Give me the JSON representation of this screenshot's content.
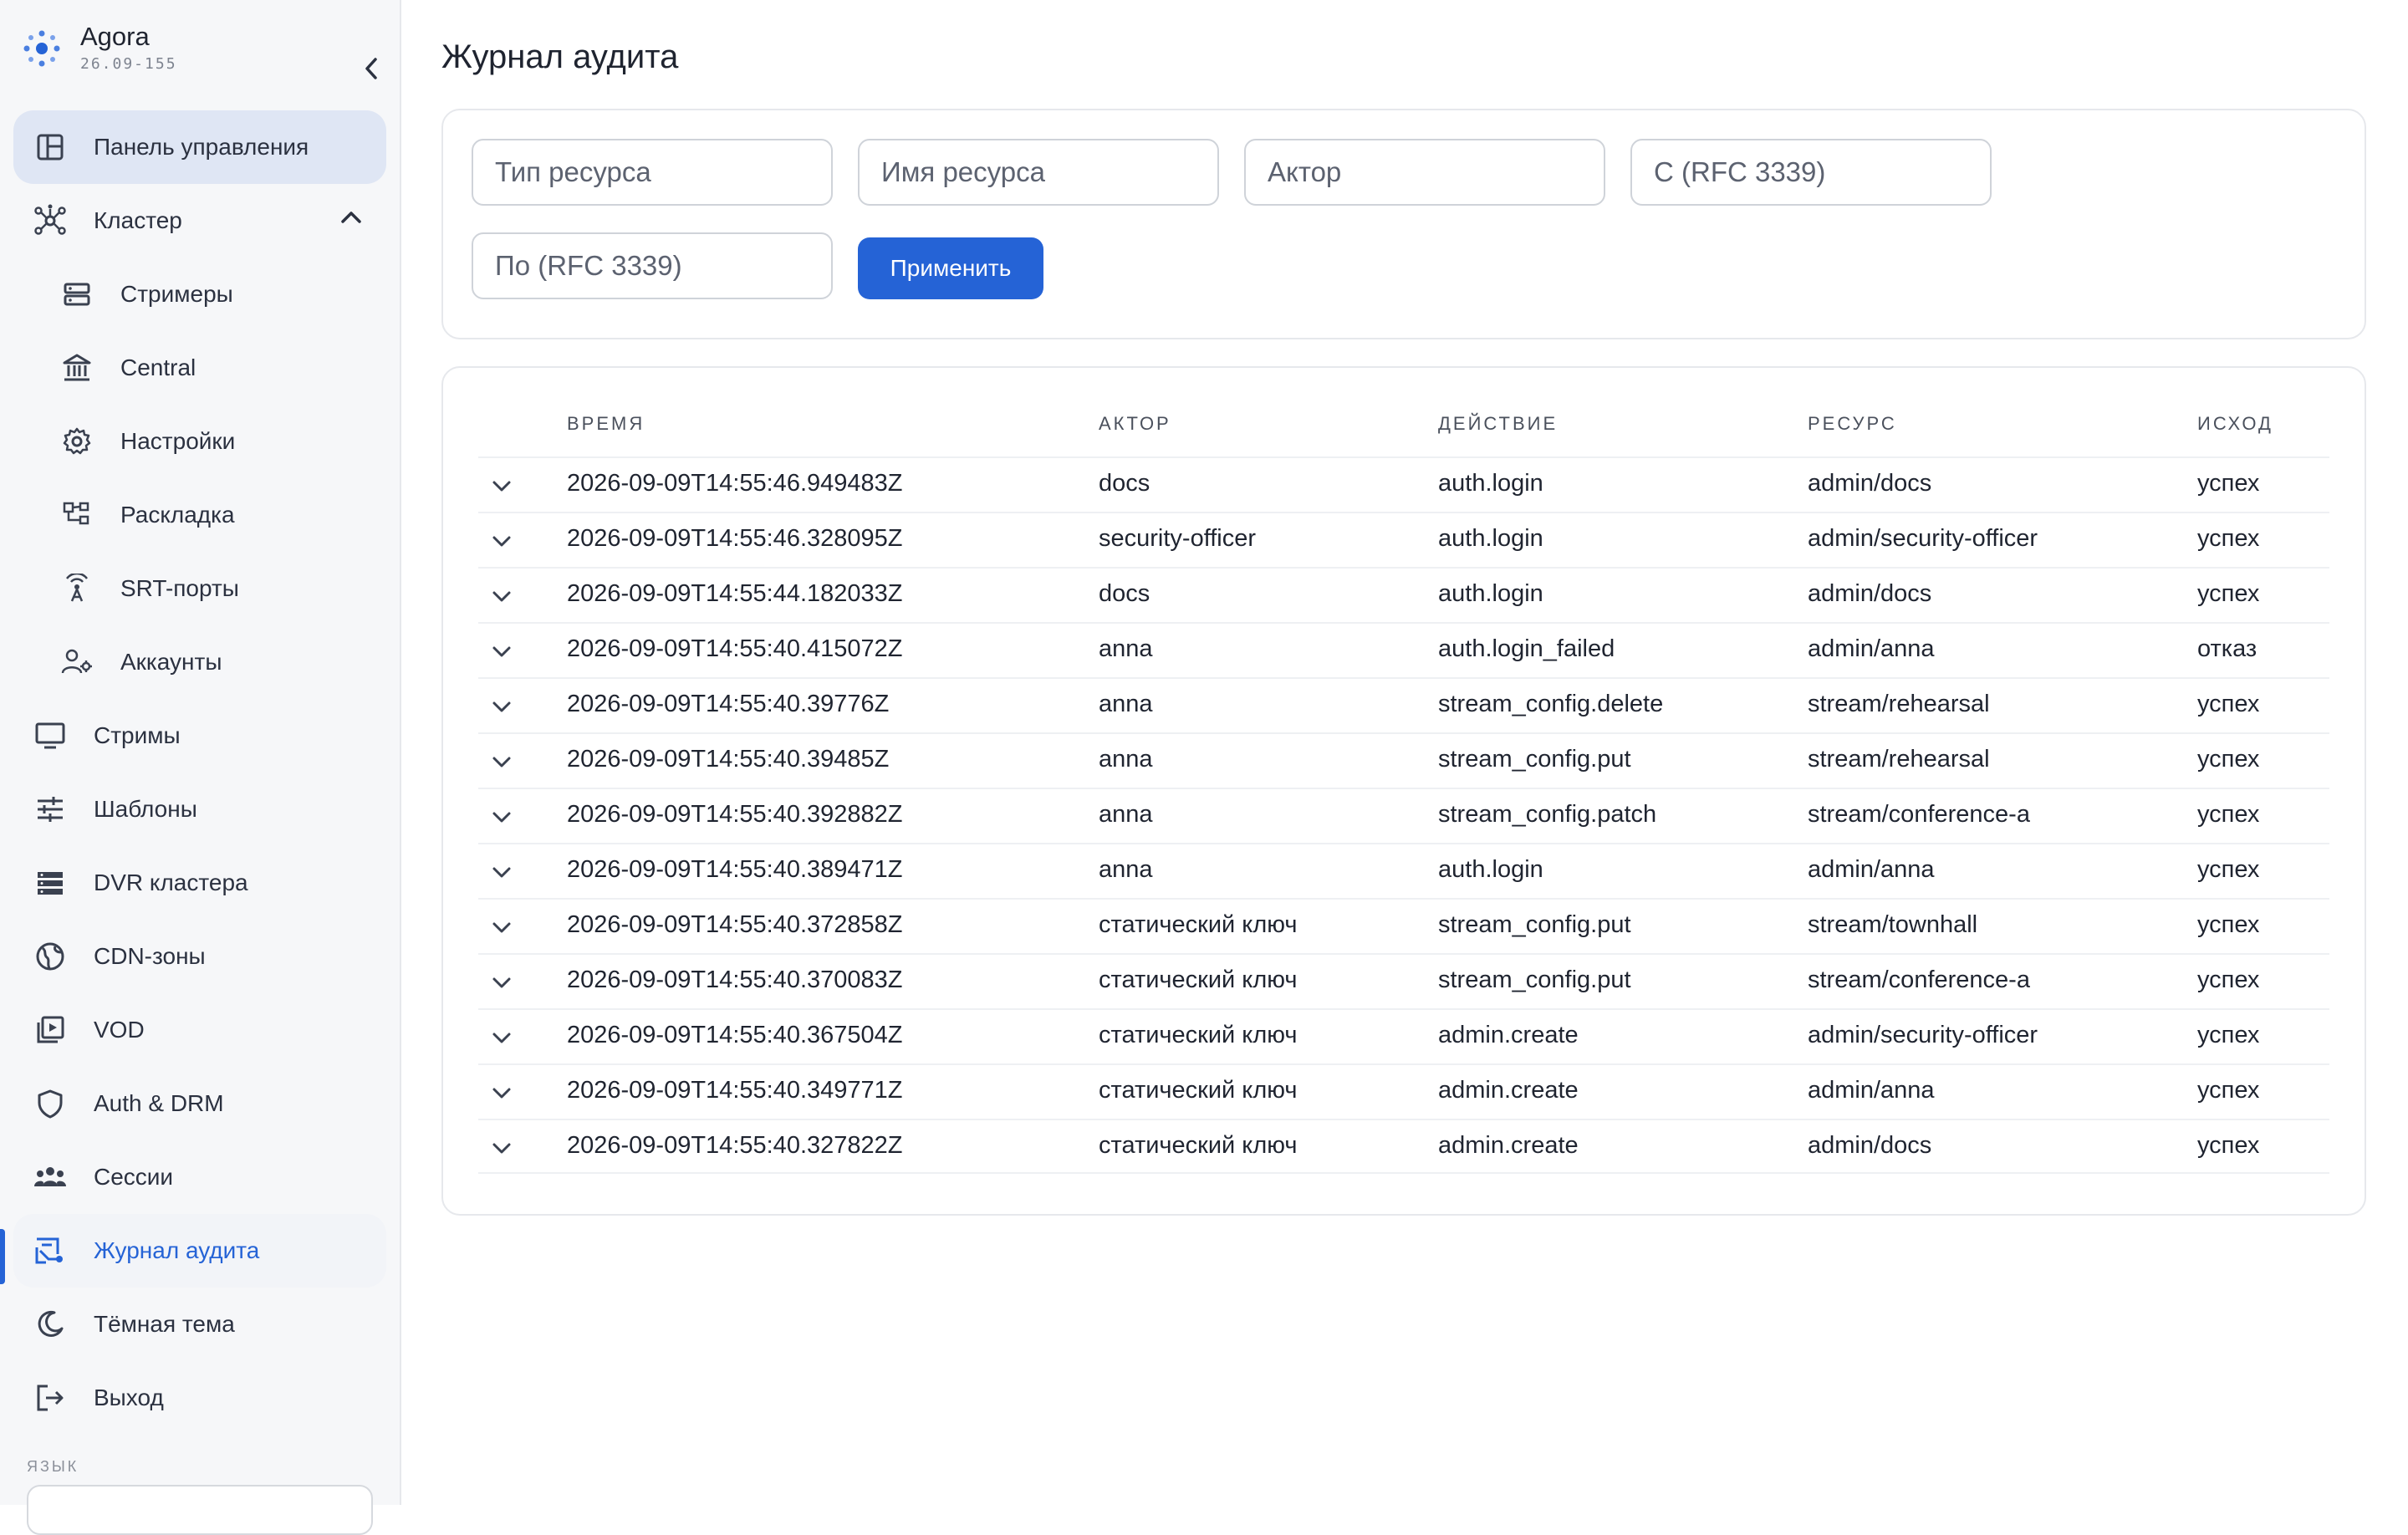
{
  "brand": {
    "name": "Agora",
    "version": "26.09-155"
  },
  "colors": {
    "accent": "#2563d6",
    "selected_bg": "#dfe6f4",
    "sidebar_bg": "#f6f7f9"
  },
  "sidebar": {
    "items": [
      {
        "label": "Панель управления",
        "icon": "dashboard-icon"
      },
      {
        "label": "Кластер",
        "icon": "cluster-icon"
      },
      {
        "label": "Стримеры",
        "icon": "server-icon"
      },
      {
        "label": "Central",
        "icon": "bank-icon"
      },
      {
        "label": "Настройки",
        "icon": "gear-icon"
      },
      {
        "label": "Раскладка",
        "icon": "layout-tree-icon"
      },
      {
        "label": "SRT-порты",
        "icon": "broadcast-icon"
      },
      {
        "label": "Аккаунты",
        "icon": "user-settings-icon"
      },
      {
        "label": "Стримы",
        "icon": "monitor-icon"
      },
      {
        "label": "Шаблоны",
        "icon": "sliders-icon"
      },
      {
        "label": "DVR кластера",
        "icon": "storage-icon"
      },
      {
        "label": "CDN-зоны",
        "icon": "globe-icon"
      },
      {
        "label": "VOD",
        "icon": "video-library-icon"
      },
      {
        "label": "Auth & DRM",
        "icon": "shield-icon"
      },
      {
        "label": "Сессии",
        "icon": "users-icon"
      },
      {
        "label": "Журнал аудита",
        "icon": "audit-log-icon"
      },
      {
        "label": "Тёмная тема",
        "icon": "moon-icon"
      },
      {
        "label": "Выход",
        "icon": "logout-icon"
      }
    ],
    "language_label": "ЯЗЫК"
  },
  "page": {
    "title": "Журнал аудита"
  },
  "filters": {
    "resource_type_placeholder": "Тип ресурса",
    "resource_name_placeholder": "Имя ресурса",
    "actor_placeholder": "Актор",
    "from_placeholder": "С (RFC 3339)",
    "to_placeholder": "По (RFC 3339)",
    "apply_label": "Применить"
  },
  "table": {
    "headers": {
      "time": "Время",
      "actor": "Актор",
      "action": "Действие",
      "resource": "Ресурс",
      "outcome": "Исход"
    },
    "rows": [
      {
        "time": "2026-09-09T14:55:46.949483Z",
        "actor": "docs",
        "action": "auth.login",
        "resource": "admin/docs",
        "outcome": "успех"
      },
      {
        "time": "2026-09-09T14:55:46.328095Z",
        "actor": "security-officer",
        "action": "auth.login",
        "resource": "admin/security-officer",
        "outcome": "успех"
      },
      {
        "time": "2026-09-09T14:55:44.182033Z",
        "actor": "docs",
        "action": "auth.login",
        "resource": "admin/docs",
        "outcome": "успех"
      },
      {
        "time": "2026-09-09T14:55:40.415072Z",
        "actor": "anna",
        "action": "auth.login_failed",
        "resource": "admin/anna",
        "outcome": "отказ"
      },
      {
        "time": "2026-09-09T14:55:40.39776Z",
        "actor": "anna",
        "action": "stream_config.delete",
        "resource": "stream/rehearsal",
        "outcome": "успех"
      },
      {
        "time": "2026-09-09T14:55:40.39485Z",
        "actor": "anna",
        "action": "stream_config.put",
        "resource": "stream/rehearsal",
        "outcome": "успех"
      },
      {
        "time": "2026-09-09T14:55:40.392882Z",
        "actor": "anna",
        "action": "stream_config.patch",
        "resource": "stream/conference-a",
        "outcome": "успех"
      },
      {
        "time": "2026-09-09T14:55:40.389471Z",
        "actor": "anna",
        "action": "auth.login",
        "resource": "admin/anna",
        "outcome": "успех"
      },
      {
        "time": "2026-09-09T14:55:40.372858Z",
        "actor": "статический ключ",
        "action": "stream_config.put",
        "resource": "stream/townhall",
        "outcome": "успех"
      },
      {
        "time": "2026-09-09T14:55:40.370083Z",
        "actor": "статический ключ",
        "action": "stream_config.put",
        "resource": "stream/conference-a",
        "outcome": "успех"
      },
      {
        "time": "2026-09-09T14:55:40.367504Z",
        "actor": "статический ключ",
        "action": "admin.create",
        "resource": "admin/security-officer",
        "outcome": "успех"
      },
      {
        "time": "2026-09-09T14:55:40.349771Z",
        "actor": "статический ключ",
        "action": "admin.create",
        "resource": "admin/anna",
        "outcome": "успех"
      },
      {
        "time": "2026-09-09T14:55:40.327822Z",
        "actor": "статический ключ",
        "action": "admin.create",
        "resource": "admin/docs",
        "outcome": "успех"
      }
    ]
  }
}
